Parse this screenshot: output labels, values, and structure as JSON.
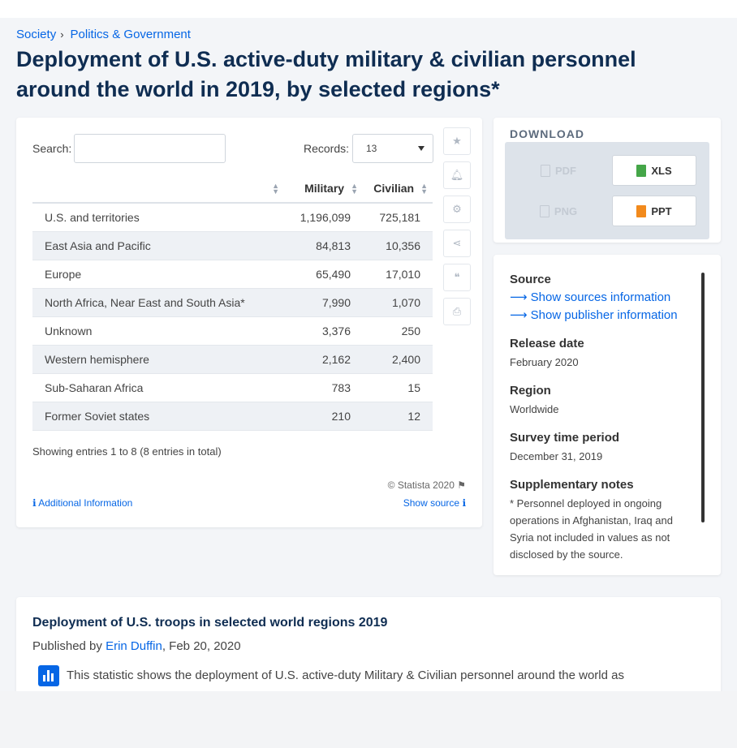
{
  "breadcrumb": {
    "items": [
      "Society",
      "Politics & Government"
    ]
  },
  "title": "Deployment of U.S. active-duty military & civilian personnel around the world in 2019, by selected regions*",
  "table": {
    "search_label": "Search:",
    "records_label": "Records:",
    "records_value": "13",
    "columns": [
      "",
      "Military",
      "Civilian"
    ],
    "rows": [
      [
        "U.S. and territories",
        "1,196,099",
        "725,181"
      ],
      [
        "East Asia and Pacific",
        "84,813",
        "10,356"
      ],
      [
        "Europe",
        "65,490",
        "17,010"
      ],
      [
        "North Africa, Near East and South Asia*",
        "7,990",
        "1,070"
      ],
      [
        "Unknown",
        "3,376",
        "250"
      ],
      [
        "Western hemisphere",
        "2,162",
        "2,400"
      ],
      [
        "Sub-Saharan Africa",
        "783",
        "15"
      ],
      [
        "Former Soviet states",
        "210",
        "12"
      ]
    ],
    "entries_text": "Showing entries 1 to 8 (8 entries in total)",
    "copyright": "© Statista 2020",
    "additional_info": "Additional Information",
    "show_source": "Show source"
  },
  "tools": [
    "star-icon",
    "bell-icon",
    "gear-icon",
    "share-icon",
    "quote-icon",
    "print-icon"
  ],
  "download": {
    "title": "DOWNLOAD",
    "pdf": "PDF",
    "xls": "XLS",
    "png": "PNG",
    "ppt": "PPT"
  },
  "source": {
    "source_heading": "Source",
    "show_sources": "Show sources information",
    "show_publisher": "Show publisher information",
    "release_heading": "Release date",
    "release_value": "February 2020",
    "region_heading": "Region",
    "region_value": "Worldwide",
    "survey_heading": "Survey time period",
    "survey_value": "December 31, 2019",
    "notes_heading": "Supplementary notes",
    "notes_value": "* Personnel deployed in ongoing operations in Afghanistan, Iraq and Syria not included in values as not disclosed by the source."
  },
  "description": {
    "title": "Deployment of U.S. troops in selected world regions 2019",
    "published_prefix": "Published by",
    "author": "Erin Duffin",
    "date": ", Feb 20, 2020",
    "text": "This statistic shows the deployment of U.S. active-duty Military & Civilian personnel around the world as"
  },
  "colors": {
    "accent": "#0666e5",
    "title": "#0f2d52"
  }
}
